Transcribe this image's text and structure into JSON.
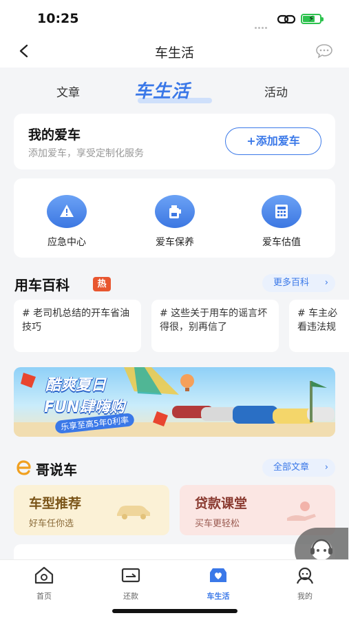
{
  "status": {
    "time": "10:25"
  },
  "nav": {
    "title": "车生活"
  },
  "tabs": [
    {
      "label": "文章"
    },
    {
      "label": "车生活"
    },
    {
      "label": "活动"
    }
  ],
  "my_car": {
    "title": "我的爱车",
    "subtitle": "添加爱车，享受定制化服务",
    "add_button": "+添加爱车"
  },
  "services": [
    {
      "label": "应急中心",
      "icon": "warning-icon"
    },
    {
      "label": "爱车保养",
      "icon": "oil-can-icon"
    },
    {
      "label": "爱车估值",
      "icon": "calculator-icon"
    }
  ],
  "wiki": {
    "title": "用车百科",
    "badge": "热",
    "more": "更多百科",
    "articles": [
      {
        "text": "# 老司机总结的开车省油技巧"
      },
      {
        "text": "# 这些关于用车的谣言坏得很，别再信了"
      },
      {
        "text": "# 车主必看违法规"
      }
    ]
  },
  "banner": {
    "line1": "酷爽夏日",
    "line2": "FUN肆嗨购",
    "sub": "乐享至高5年0利率"
  },
  "echar": {
    "title": "哥说车",
    "more": "全部文章",
    "promos": [
      {
        "title": "车型推荐",
        "sub": "好车任你选"
      },
      {
        "title": "贷款课堂",
        "sub": "买车更轻松"
      }
    ]
  },
  "tab_bar": [
    {
      "label": "首页",
      "icon": "home-icon"
    },
    {
      "label": "还款",
      "icon": "card-icon"
    },
    {
      "label": "车生活",
      "icon": "car-life-icon",
      "active": true
    },
    {
      "label": "我的",
      "icon": "profile-icon"
    }
  ],
  "colors": {
    "accent": "#3a78e8",
    "hot": "#e8562f",
    "battery": "#2dc24e"
  }
}
